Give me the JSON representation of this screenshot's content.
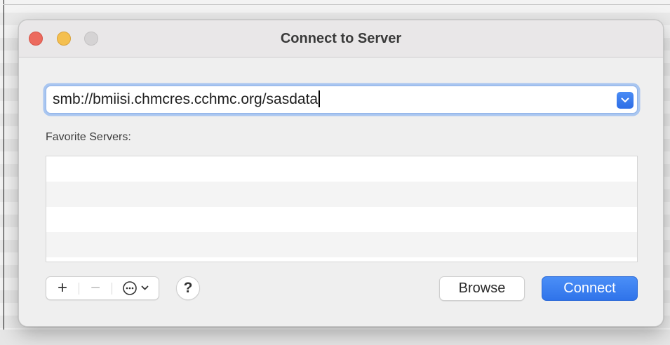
{
  "window": {
    "title": "Connect to Server"
  },
  "server_address": {
    "value": "smb://bmiisi.chmcres.cchmc.org/sasdata"
  },
  "favorites": {
    "label": "Favorite Servers:",
    "items": []
  },
  "toolbar": {
    "add_symbol": "+",
    "remove_symbol": "−",
    "help_symbol": "?"
  },
  "buttons": {
    "browse_label": "Browse",
    "connect_label": "Connect"
  },
  "colors": {
    "accent": "#2f73ea",
    "close": "#ec6a5e",
    "minimize": "#f4bf4f",
    "zoom_inactive": "#d5d3d4"
  },
  "icons": {
    "dropdown": "chevron-down-icon",
    "action_menu": "ellipsis-circle-icon"
  }
}
